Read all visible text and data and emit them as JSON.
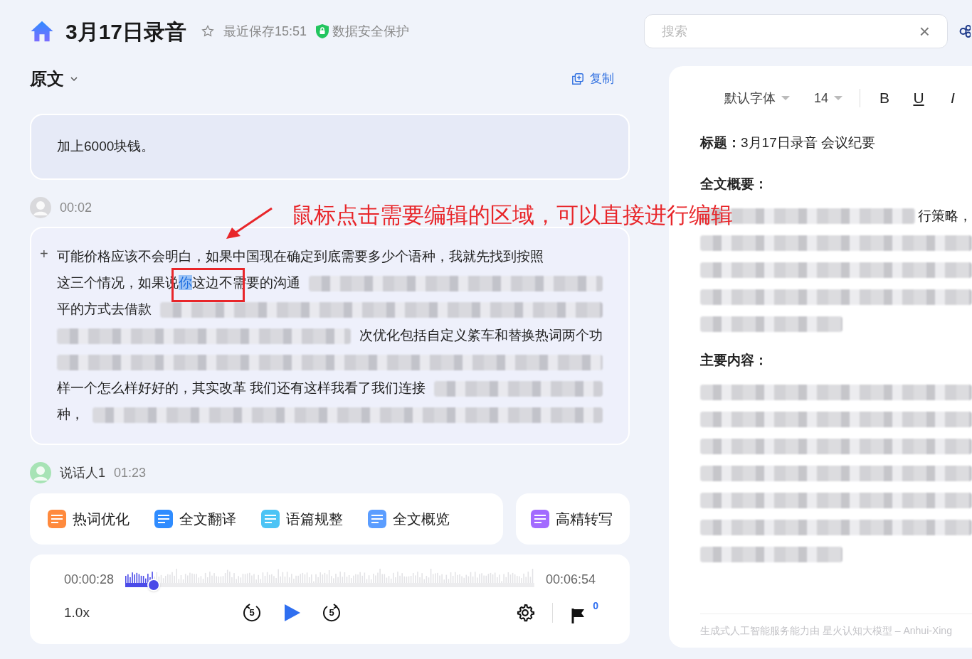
{
  "header": {
    "title": "3月17日录音",
    "saved": "最近保存15:51",
    "security": "数据安全保护"
  },
  "search": {
    "placeholder": "搜索",
    "clear": "×"
  },
  "transcript": {
    "view": "原文",
    "copy": "复制",
    "segments": [
      {
        "kind": "plain",
        "lines": [
          [
            {
              "kind": "text",
              "text": "加上6000块钱。",
              "selected": false
            }
          ]
        ]
      },
      {
        "kind": "editing",
        "time": "00:02",
        "marker": "+",
        "lines": [
          [
            {
              "kind": "text",
              "text": "可能价格应该不会明白，如果中国现在确定到底需要多少个语种，我就先找到按照",
              "selected": false
            }
          ],
          [
            {
              "kind": "text",
              "text": "这三个情况，如果说",
              "selected": false
            },
            {
              "kind": "text",
              "text": "你",
              "selected": true
            },
            {
              "kind": "text",
              "text": "这边不需要的沟通",
              "selected": false
            },
            {
              "kind": "blur"
            }
          ],
          [
            {
              "kind": "text",
              "text": "平的方式去借款",
              "selected": false
            },
            {
              "kind": "blur"
            }
          ],
          [
            {
              "kind": "blur"
            },
            {
              "kind": "text",
              "text": "次优化包括自定义綮车和替换热词两个功",
              "selected": false
            }
          ],
          [
            {
              "kind": "blur"
            }
          ],
          [
            {
              "kind": "text",
              "text": "样一个怎么样好好的，其实改革 我们还有这样我看了我们连接",
              "selected": false
            },
            {
              "kind": "blur"
            }
          ],
          [
            {
              "kind": "text",
              "text": "种，",
              "selected": false
            },
            {
              "kind": "blur"
            }
          ]
        ]
      },
      {
        "kind": "speaker",
        "speaker": "说话人1",
        "time": "01:23"
      }
    ]
  },
  "annotation": {
    "text": "鼠标点击需要编辑的区域，可以直接进行编辑"
  },
  "tools": [
    {
      "kind": "hotword",
      "label": "热词优化"
    },
    {
      "kind": "translate",
      "label": "全文翻译"
    },
    {
      "kind": "tidy",
      "label": "语篇规整"
    },
    {
      "kind": "overview",
      "label": "全文概览"
    },
    {
      "kind": "precise",
      "label": "高精转写"
    }
  ],
  "player": {
    "current": "00:00:28",
    "total": "00:06:54",
    "level": 0.07,
    "speed": "1.0x",
    "back": "5",
    "forward": "5",
    "marks": "0"
  },
  "notes": {
    "toolbar": {
      "font": "默认字体",
      "size": "14",
      "bold": "B",
      "underline": "U",
      "italic": "I"
    },
    "blocks": [
      {
        "kind": "title",
        "text": "**标题：**3月17日录音 会议纪要"
      },
      {
        "kind": "heading",
        "text": "全文概要："
      },
      {
        "kind": "line",
        "parts": [
          {
            "kind": "blur"
          },
          {
            "kind": "text",
            "text": "行策略，"
          }
        ]
      },
      {
        "kind": "line",
        "parts": [
          {
            "kind": "blur"
          }
        ]
      },
      {
        "kind": "line",
        "parts": [
          {
            "kind": "blur"
          }
        ]
      },
      {
        "kind": "line",
        "parts": [
          {
            "kind": "blur"
          }
        ]
      },
      {
        "kind": "line",
        "parts": [
          {
            "kind": "blur_short"
          }
        ]
      },
      {
        "kind": "heading",
        "text": "主要内容："
      },
      {
        "kind": "line",
        "parts": [
          {
            "kind": "blur"
          }
        ]
      },
      {
        "kind": "line",
        "parts": [
          {
            "kind": "blur"
          }
        ]
      },
      {
        "kind": "line",
        "parts": [
          {
            "kind": "blur"
          }
        ]
      },
      {
        "kind": "line",
        "parts": [
          {
            "kind": "blur"
          }
        ]
      },
      {
        "kind": "line",
        "parts": [
          {
            "kind": "blur"
          }
        ]
      },
      {
        "kind": "line",
        "parts": [
          {
            "kind": "blur"
          }
        ]
      },
      {
        "kind": "line",
        "parts": [
          {
            "kind": "blur_short"
          }
        ]
      }
    ],
    "footer": "生成式人工智能服务能力由 星火认知大模型 – Anhui-Xing"
  }
}
